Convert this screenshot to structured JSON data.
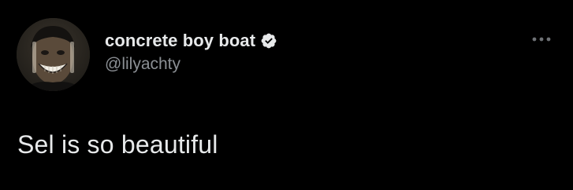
{
  "tweet": {
    "author": {
      "display_name": "concrete boy boat",
      "handle": "@lilyachty",
      "verified": true
    },
    "text": "Sel is so beautiful"
  },
  "icons": {
    "verified": "verified-badge-icon",
    "more": "more-horizontal-icon"
  },
  "colors": {
    "background": "#000000",
    "primary_text": "#e7e9ea",
    "secondary_text": "#8b8f94",
    "badge": "#e7e9ea"
  }
}
